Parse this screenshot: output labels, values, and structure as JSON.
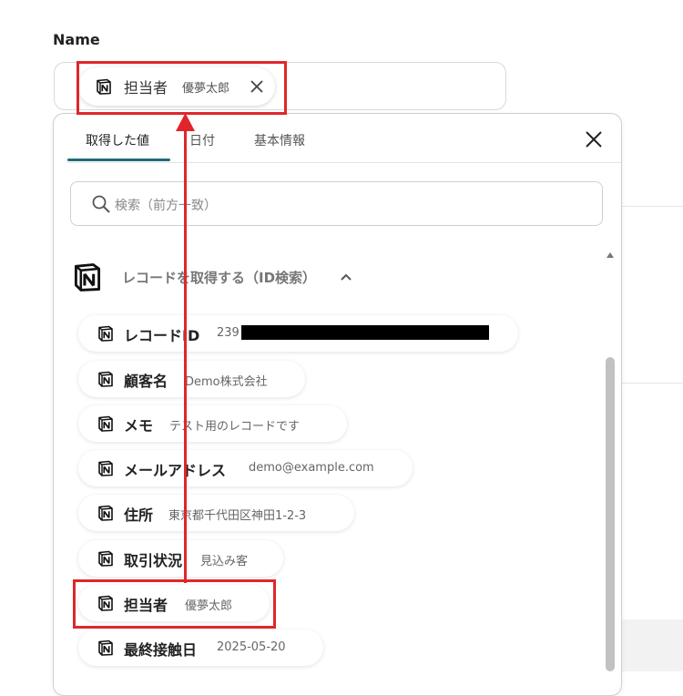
{
  "field": {
    "label": "Name",
    "selected_chip": {
      "key": "担当者",
      "value": "優夢太郎"
    }
  },
  "dropdown": {
    "tabs": [
      {
        "label": "取得した値",
        "active": true
      },
      {
        "label": "日付",
        "active": false
      },
      {
        "label": "基本情報",
        "active": false
      }
    ],
    "search_placeholder": "検索（前方一致）",
    "section": {
      "title": "レコードを取得する（ID検索）"
    },
    "items": [
      {
        "key": "レコードID",
        "value": "239"
      },
      {
        "key": "顧客名",
        "value": "Demo株式会社"
      },
      {
        "key": "メモ",
        "value": "テスト用のレコードです"
      },
      {
        "key": "メールアドレス",
        "value": "demo@example.com"
      },
      {
        "key": "住所",
        "value": "東京都千代田区神田1-2-3"
      },
      {
        "key": "取引状況",
        "value": "見込み客"
      },
      {
        "key": "担当者",
        "value": "優夢太郎"
      },
      {
        "key": "最終接触日",
        "value": "2025-05-20"
      }
    ]
  },
  "colors": {
    "accent": "#1f6b7a",
    "highlight": "#e0262b"
  },
  "icons": [
    "notion-icon",
    "close-icon",
    "search-icon",
    "chevron-up-icon"
  ]
}
